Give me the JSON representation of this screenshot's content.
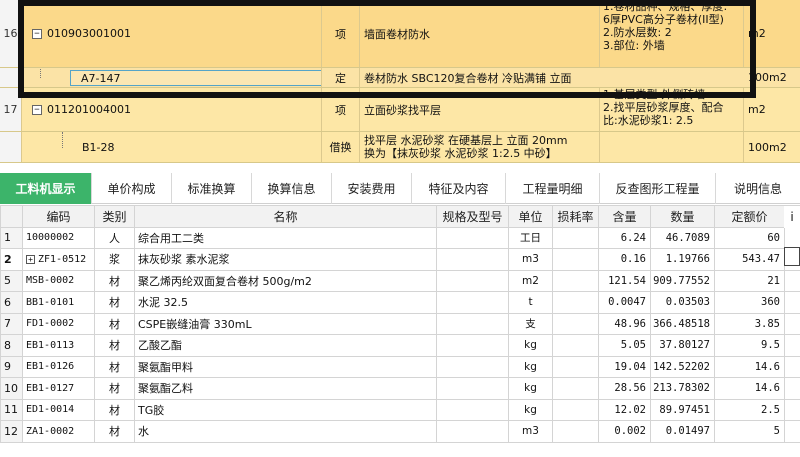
{
  "top_rows": [
    {
      "num": "16",
      "code": "010903001001",
      "unit_type": "项",
      "name": "墙面卷材防水",
      "features": [
        "1.卷材品种、规格、厚度:",
        "6厚PVC高分子卷材(II型)",
        "2.防水层数: 2",
        "3.部位: 外墙"
      ],
      "unit": "m2"
    },
    {
      "code": "A7-147",
      "unit_type": "定",
      "name": "卷材防水 SBC120复合卷材 冷贴满铺 立面",
      "unit": "100m2",
      "more": "···"
    },
    {
      "num": "17",
      "code": "011201004001",
      "unit_type": "项",
      "name": "立面砂浆找平层",
      "features": [
        "1.基层类型:外侧砖墙",
        "2.找平层砂浆厚度、配合",
        "比:水泥砂浆1: 2.5"
      ],
      "unit": "m2"
    },
    {
      "code": "B1-28",
      "unit_type": "借换",
      "name_lines": [
        "找平层 水泥砂浆 在硬基层上 立面 20mm",
        "换为【抹灰砂浆 水泥砂浆 1:2.5 中砂】"
      ],
      "unit": "100m2"
    }
  ],
  "tabs": [
    "工料机显示",
    "单价构成",
    "标准换算",
    "换算信息",
    "安装费用",
    "特征及内容",
    "工程量明细",
    "反查图形工程量",
    "说明信息"
  ],
  "table": {
    "headers": [
      "编码",
      "类别",
      "名称",
      "规格及型号",
      "单位",
      "损耗率",
      "含量",
      "数量",
      "定额价"
    ],
    "rows": [
      {
        "ln": "1",
        "code": "10000002",
        "cat": "人",
        "name": "综合用工二类",
        "spec": "",
        "unit": "工日",
        "loss": "",
        "content": "6.24",
        "qty": "46.7089",
        "price": "60"
      },
      {
        "ln": "2",
        "code": "ZF1-0512",
        "cat": "浆",
        "name": "抹灰砂浆 素水泥浆",
        "spec": "",
        "unit": "m3",
        "loss": "",
        "content": "0.16",
        "qty": "1.19766",
        "price": "543.47",
        "expand": "+"
      },
      {
        "ln": "5",
        "code": "MSB-0002",
        "cat": "材",
        "name": "聚乙烯丙纶双面复合卷材 500g/m2",
        "spec": "",
        "unit": "m2",
        "loss": "",
        "content": "121.54",
        "qty": "909.77552",
        "price": "21"
      },
      {
        "ln": "6",
        "code": "BB1-0101",
        "cat": "材",
        "name": "水泥 32.5",
        "spec": "",
        "unit": "t",
        "loss": "",
        "content": "0.0047",
        "qty": "0.03503",
        "price": "360"
      },
      {
        "ln": "7",
        "code": "FD1-0002",
        "cat": "材",
        "name": "CSPE嵌缝油膏 330mL",
        "spec": "",
        "unit": "支",
        "loss": "",
        "content": "48.96",
        "qty": "366.48518",
        "price": "3.85"
      },
      {
        "ln": "8",
        "code": "EB1-0113",
        "cat": "材",
        "name": "乙酸乙酯",
        "spec": "",
        "unit": "kg",
        "loss": "",
        "content": "5.05",
        "qty": "37.80127",
        "price": "9.5"
      },
      {
        "ln": "9",
        "code": "EB1-0126",
        "cat": "材",
        "name": "聚氨酯甲料",
        "spec": "",
        "unit": "kg",
        "loss": "",
        "content": "19.04",
        "qty": "142.52202",
        "price": "14.6"
      },
      {
        "ln": "10",
        "code": "EB1-0127",
        "cat": "材",
        "name": "聚氨酯乙料",
        "spec": "",
        "unit": "kg",
        "loss": "",
        "content": "28.56",
        "qty": "213.78302",
        "price": "14.6"
      },
      {
        "ln": "11",
        "code": "ED1-0014",
        "cat": "材",
        "name": "TG胶",
        "spec": "",
        "unit": "kg",
        "loss": "",
        "content": "12.02",
        "qty": "89.97451",
        "price": "2.5"
      },
      {
        "ln": "12",
        "code": "ZA1-0002",
        "cat": "材",
        "name": "水",
        "spec": "",
        "unit": "m3",
        "loss": "",
        "content": "0.002",
        "qty": "0.01497",
        "price": "5"
      }
    ]
  },
  "edge_glyph": "ⅰ",
  "colors": {
    "tab_active": "#3cb46a",
    "row_bg": "#fbd98a",
    "selection_border": "#111111"
  }
}
